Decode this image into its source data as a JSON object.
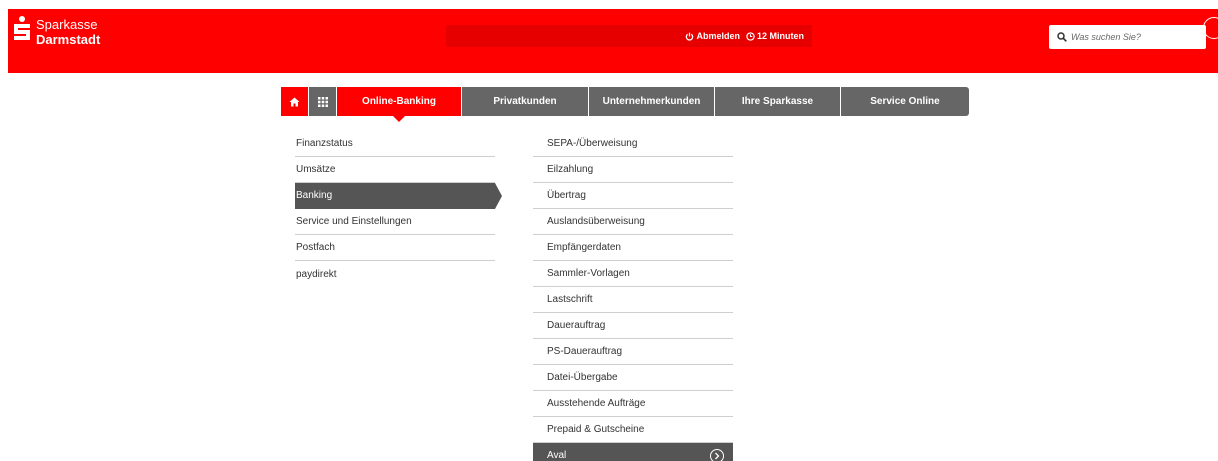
{
  "brand": {
    "name_line1": "Sparkasse",
    "name_line2": "Darmstadt",
    "color": "#ff0000"
  },
  "session": {
    "logout_label": "Abmelden",
    "timer_label": "12 Minuten",
    "logout_icon": "power-icon",
    "timer_icon": "clock-icon"
  },
  "search": {
    "placeholder": "Was suchen Sie?",
    "icon": "search-icon"
  },
  "nav": {
    "home_icon": "home-icon",
    "grid_icon": "grid-icon",
    "tabs": [
      {
        "label": "Online-Banking",
        "active": true
      },
      {
        "label": "Privatkunden",
        "active": false
      },
      {
        "label": "Unternehmerkunden",
        "active": false
      },
      {
        "label": "Ihre Sparkasse",
        "active": false
      },
      {
        "label": "Service Online",
        "active": false
      }
    ]
  },
  "left_menu": {
    "items": [
      {
        "label": "Finanzstatus",
        "active": false
      },
      {
        "label": "Umsätze",
        "active": false
      },
      {
        "label": "Banking",
        "active": true
      },
      {
        "label": "Service und Einstellungen",
        "active": false
      },
      {
        "label": "Postfach",
        "active": false
      },
      {
        "label": "paydirekt",
        "active": false
      }
    ]
  },
  "right_menu": {
    "items": [
      {
        "label": "SEPA-/Überweisung",
        "active": false
      },
      {
        "label": "Eilzahlung",
        "active": false
      },
      {
        "label": "Übertrag",
        "active": false
      },
      {
        "label": "Auslandsüberweisung",
        "active": false
      },
      {
        "label": "Empfängerdaten",
        "active": false
      },
      {
        "label": "Sammler-Vorlagen",
        "active": false
      },
      {
        "label": "Lastschrift",
        "active": false
      },
      {
        "label": "Dauerauftrag",
        "active": false
      },
      {
        "label": "PS-Dauerauftrag",
        "active": false
      },
      {
        "label": "Datei-Übergabe",
        "active": false
      },
      {
        "label": "Ausstehende Aufträge",
        "active": false
      },
      {
        "label": "Prepaid & Gutscheine",
        "active": false
      },
      {
        "label": "Aval",
        "active": true
      }
    ]
  },
  "colors": {
    "nav_inactive": "#666666",
    "menu_active": "#555555",
    "divider": "#cfcfcf"
  }
}
